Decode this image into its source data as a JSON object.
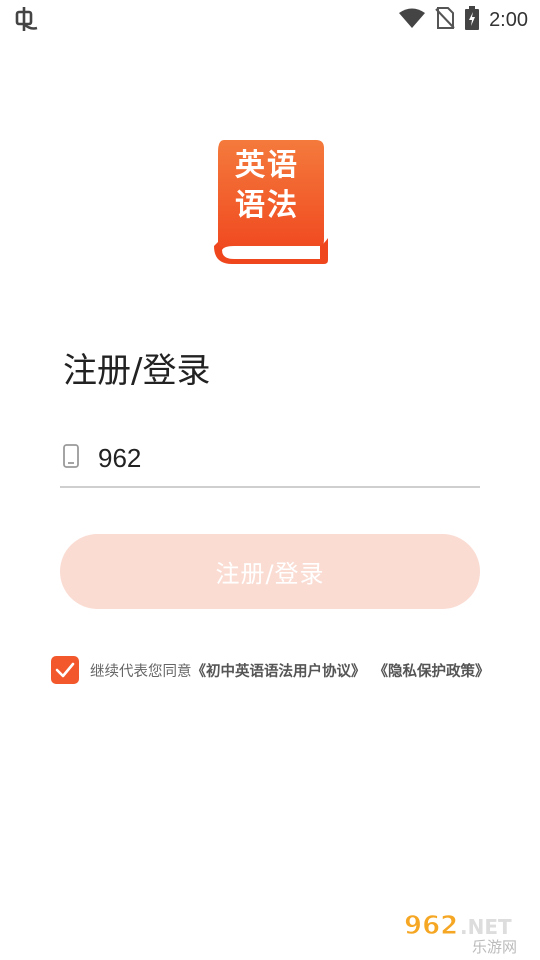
{
  "status_bar": {
    "time": "2:00",
    "left_icon": "bug-icon",
    "icons": [
      "wifi-icon",
      "no-sim-icon",
      "battery-charging-icon"
    ]
  },
  "logo": {
    "line1": "英语",
    "line2": "语法",
    "colors": {
      "top": "#f47a3c",
      "bottom": "#f0461e",
      "pages": "#ffffff"
    }
  },
  "page": {
    "title": "注册/登录"
  },
  "phone": {
    "icon": "phone-icon",
    "value": "962",
    "placeholder": ""
  },
  "submit": {
    "label": "注册/登录",
    "color": "#fadcd3"
  },
  "agreement": {
    "checked": true,
    "prefix": "继续代表您同意",
    "user_agreement": "《初中英语语法用户协议》",
    "privacy_policy": "《隐私保护政策》",
    "accent": "#f2582b"
  },
  "watermark": {
    "brand": "962.NET",
    "sub": "乐游网"
  }
}
